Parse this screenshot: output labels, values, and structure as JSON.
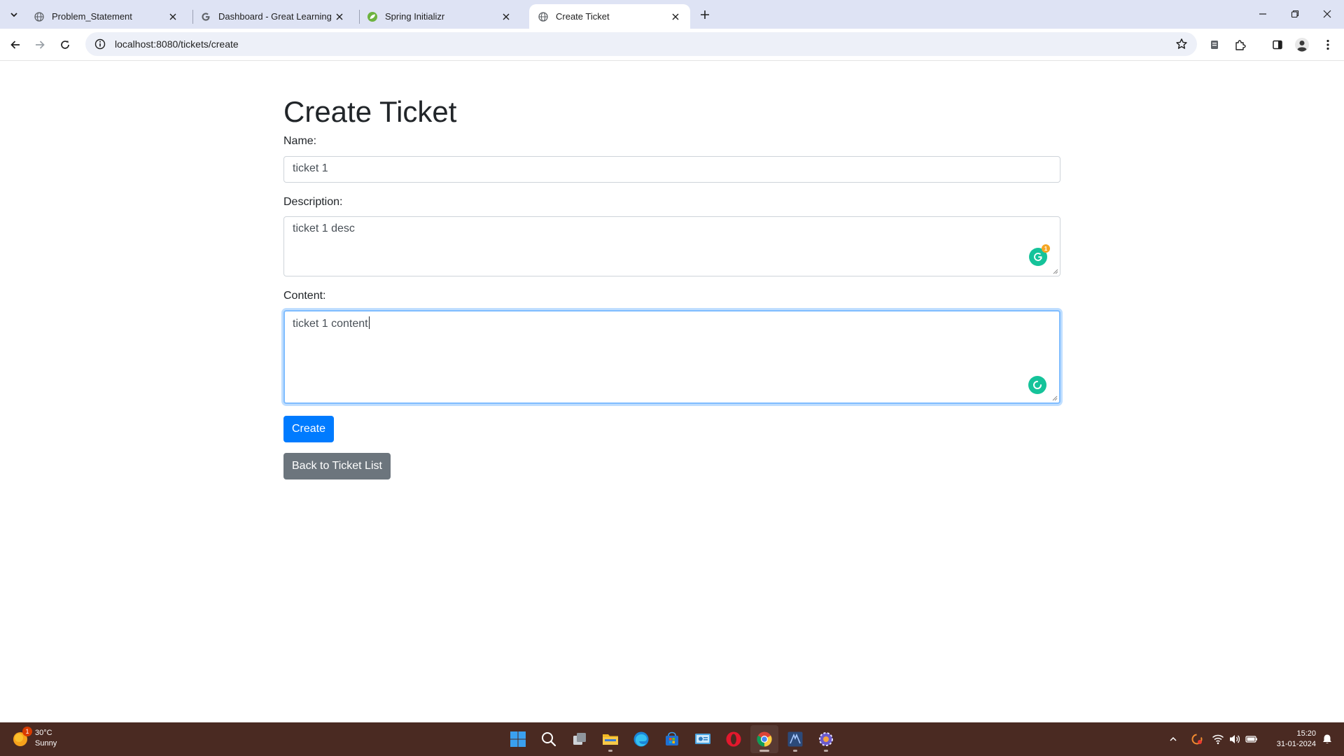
{
  "browser": {
    "tabs": [
      {
        "title": "Problem_Statement",
        "favicon": "globe-icon",
        "active": false
      },
      {
        "title": "Dashboard - Great Learning",
        "favicon": "google-g-icon",
        "active": false
      },
      {
        "title": "Spring Initializr",
        "favicon": "spring-leaf-icon",
        "active": false
      },
      {
        "title": "Create Ticket",
        "favicon": "globe-icon",
        "active": true
      }
    ],
    "url": "localhost:8080/tickets/create"
  },
  "page": {
    "title": "Create Ticket",
    "name_label": "Name:",
    "name_value": "ticket 1",
    "description_label": "Description:",
    "description_value": "ticket 1 desc",
    "content_label": "Content:",
    "content_value": "ticket 1 content",
    "grammarly_badge": "1",
    "create_button": "Create",
    "back_button": "Back to Ticket List"
  },
  "taskbar": {
    "weather_temp": "30°C",
    "weather_desc": "Sunny",
    "weather_badge": "1",
    "time": "15:20",
    "date": "31-01-2024"
  },
  "colors": {
    "primary": "#007bff",
    "secondary": "#6c757d",
    "tabstrip": "#dee3f4",
    "taskbar": "#4a2a22",
    "focus_ring": "#80bdff"
  }
}
